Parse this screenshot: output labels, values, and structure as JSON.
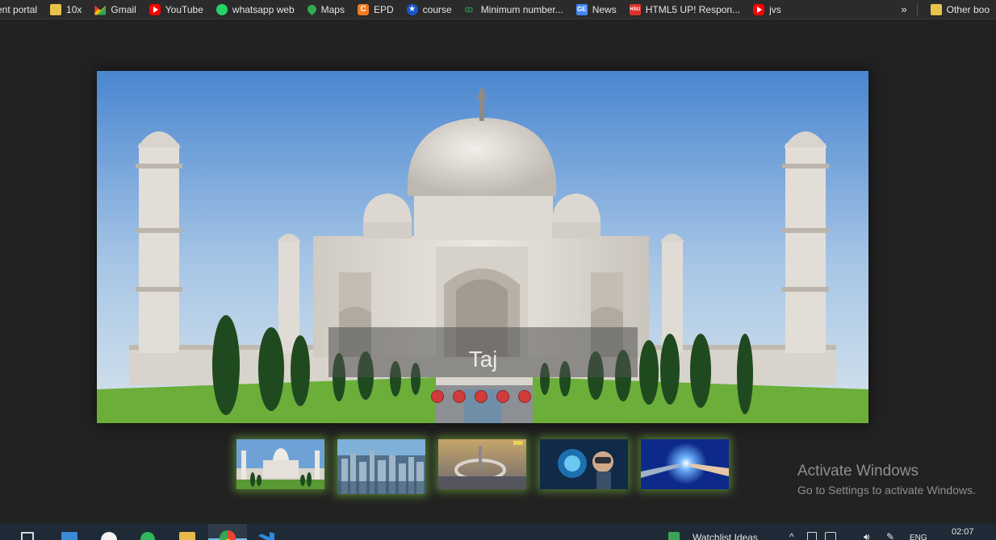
{
  "bookmarks": {
    "items": [
      {
        "label": "ent portal",
        "icon": "none"
      },
      {
        "label": "10x",
        "icon": "folder-icon"
      },
      {
        "label": "Gmail",
        "icon": "gmail-icon"
      },
      {
        "label": "YouTube",
        "icon": "youtube-icon"
      },
      {
        "label": "whatsapp web",
        "icon": "whatsapp-icon"
      },
      {
        "label": "Maps",
        "icon": "maps-icon"
      },
      {
        "label": "EPD",
        "icon": "epd-icon"
      },
      {
        "label": "course",
        "icon": "star-icon"
      },
      {
        "label": "Minimum number...",
        "icon": "gfg-icon"
      },
      {
        "label": "News",
        "icon": "news-icon"
      },
      {
        "label": "HTML5 UP! Respon...",
        "icon": "hsu-icon"
      },
      {
        "label": "jvs",
        "icon": "youtube-icon"
      }
    ],
    "overflow_label": "»",
    "other_label": "Other boo"
  },
  "slider": {
    "caption": "Taj",
    "dots": 5
  },
  "thumbnails": [
    {
      "name": "taj-mahal-thumbnail"
    },
    {
      "name": "city-skyline-thumbnail"
    },
    {
      "name": "futuristic-city-thumbnail"
    },
    {
      "name": "vr-technology-thumbnail"
    },
    {
      "name": "robot-hand-thumbnail"
    }
  ],
  "watermark": {
    "line1": "Activate Windows",
    "line2": "Go to Settings to activate Windows."
  },
  "taskbar": {
    "app_label": "Watchlist Ideas",
    "lang": "ENG",
    "time": "02:07"
  },
  "colors": {
    "page_bg": "#222222",
    "dot": "#d13b3b",
    "thumb_glow": "#78be3c"
  }
}
